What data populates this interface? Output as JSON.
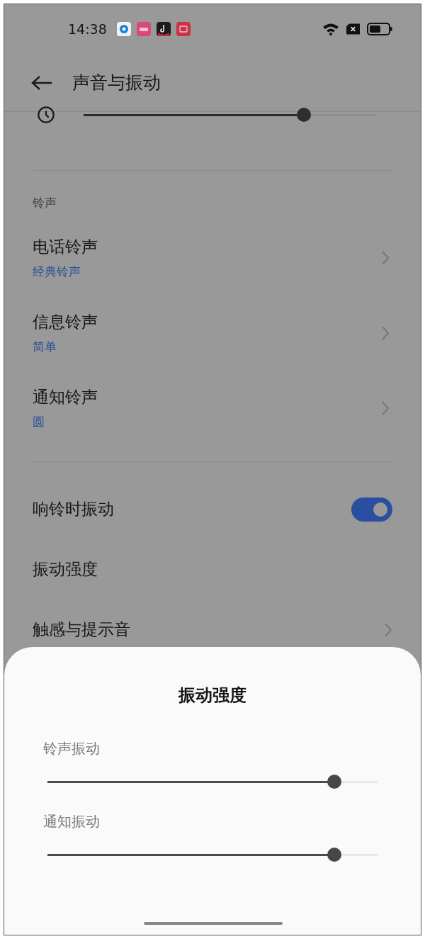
{
  "status_bar": {
    "time": "14:38"
  },
  "header": {
    "title": "声音与振动"
  },
  "volume_slider": {
    "level": 0.75
  },
  "ringtone_section": {
    "title": "铃声",
    "items": [
      {
        "label": "电话铃声",
        "value": "经典铃声"
      },
      {
        "label": "信息铃声",
        "value": "简单"
      },
      {
        "label": "通知铃声",
        "value": "圆"
      }
    ]
  },
  "settings": [
    {
      "kind": "toggle",
      "label": "响铃时振动",
      "on": true
    },
    {
      "kind": "plain",
      "label": "振动强度"
    },
    {
      "kind": "link",
      "label": "触感与提示音"
    }
  ],
  "sheet": {
    "title": "振动强度",
    "sliders": [
      {
        "label": "铃声振动",
        "level": 0.87
      },
      {
        "label": "通知振动",
        "level": 0.87
      }
    ]
  }
}
